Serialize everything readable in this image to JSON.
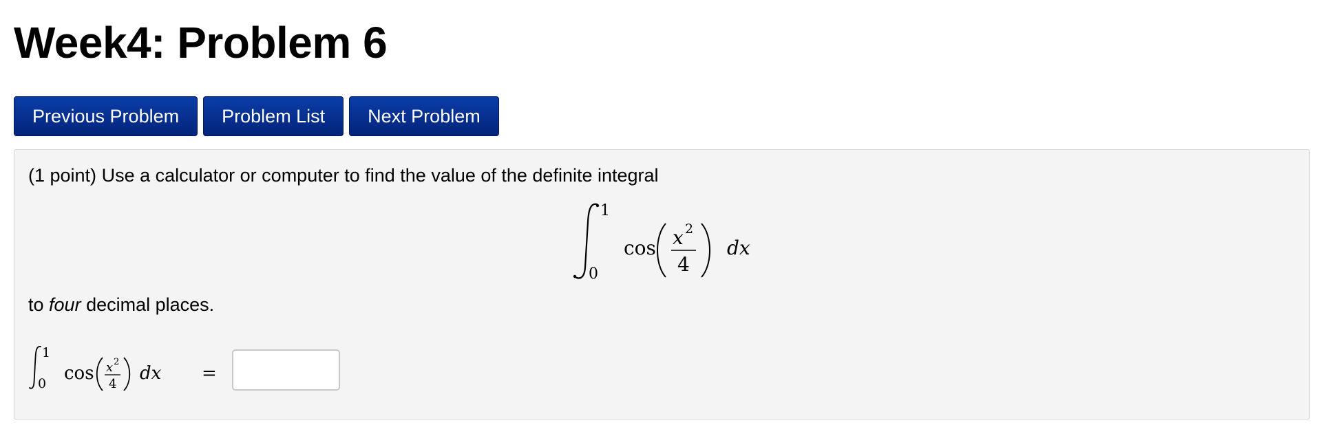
{
  "page": {
    "title": "Week4: Problem 6"
  },
  "nav": {
    "previous_label": "Previous Problem",
    "list_label": "Problem List",
    "next_label": "Next Problem"
  },
  "problem": {
    "points": "(1 point)",
    "intro_text": "Use a calculator or computer to find the value of the definite integral",
    "integral": {
      "lower": "0",
      "upper": "1",
      "func": "cos",
      "numerator_var": "x",
      "numerator_exp": "2",
      "denominator": "4",
      "differential": "dx"
    },
    "after_prefix": "to ",
    "after_emph": "four",
    "after_suffix": " decimal places.",
    "answer_equals": "=",
    "answer_value": ""
  },
  "colors": {
    "button_bg": "#04247a",
    "panel_bg": "#f4f4f4"
  }
}
